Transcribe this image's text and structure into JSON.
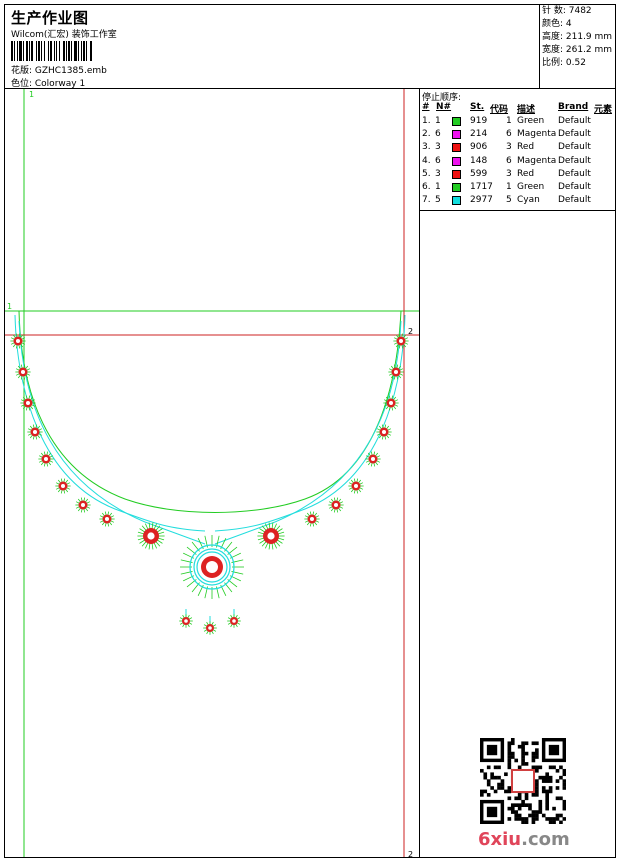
{
  "header": {
    "title": "生产作业图",
    "subtitle": "Wilcom(汇宏) 装饰工作室",
    "file": "花版:  GZHC1385.emb",
    "colorway": "色位:  Colorway 1"
  },
  "stats": {
    "stitches": "针 数: 7482",
    "colors": "颜色: 4",
    "height": "高度: 211.9 mm",
    "width": "宽度: 261.2 mm",
    "scale": "比例: 0.52"
  },
  "markers": {
    "top_left": "1",
    "left_mid": "1",
    "right_mid": "2",
    "right_bottom": "2"
  },
  "stop_sequence": {
    "title": "停止顺序:",
    "headers": [
      "#",
      "N#",
      "St.",
      "代码",
      "描述",
      "Brand",
      "元素"
    ],
    "rows": [
      {
        "num": "1.",
        "n": "1",
        "st": "919",
        "code": "1",
        "desc": "Green",
        "brand": "Default",
        "color": "#22cc22"
      },
      {
        "num": "2.",
        "n": "6",
        "st": "214",
        "code": "6",
        "desc": "Magenta",
        "brand": "Default",
        "color": "#ee11ee"
      },
      {
        "num": "3.",
        "n": "3",
        "st": "906",
        "code": "3",
        "desc": "Red",
        "brand": "Default",
        "color": "#ee1111"
      },
      {
        "num": "4.",
        "n": "6",
        "st": "148",
        "code": "6",
        "desc": "Magenta",
        "brand": "Default",
        "color": "#ee11ee"
      },
      {
        "num": "5.",
        "n": "3",
        "st": "599",
        "code": "3",
        "desc": "Red",
        "brand": "Default",
        "color": "#ee1111"
      },
      {
        "num": "6.",
        "n": "1",
        "st": "1717",
        "code": "1",
        "desc": "Green",
        "brand": "Default",
        "color": "#22cc22"
      },
      {
        "num": "7.",
        "n": "5",
        "st": "2977",
        "code": "5",
        "desc": "Cyan",
        "brand": "Default",
        "color": "#11dddd"
      }
    ]
  },
  "watermark": {
    "text": "6xiu",
    "suffix": ".com"
  },
  "colors": {
    "green": "#22cc22",
    "red": "#dd2222",
    "cyan": "#22dddd",
    "magenta": "#ee11ee"
  }
}
